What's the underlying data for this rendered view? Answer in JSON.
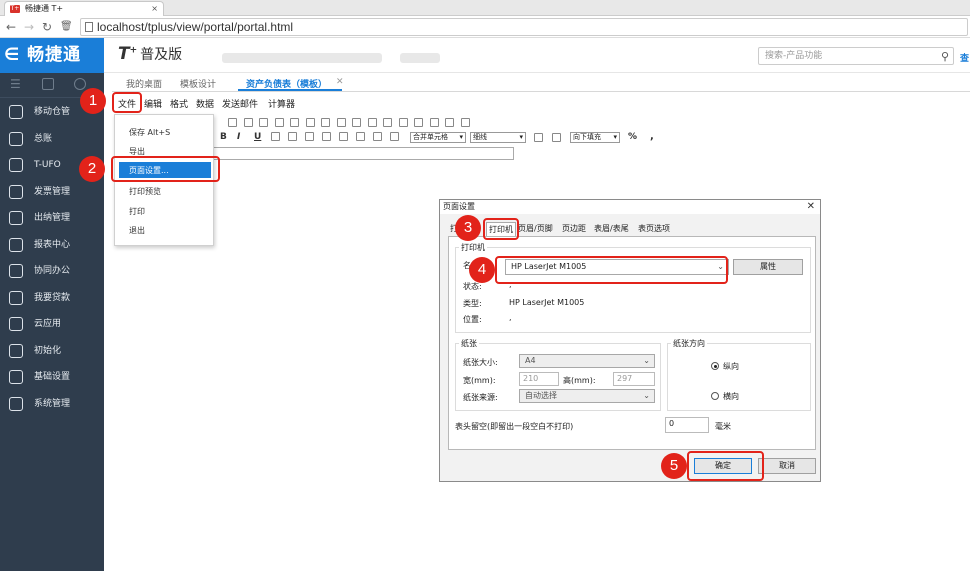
{
  "browser": {
    "tab_title": "畅捷通 T+",
    "favicon_text": "T+",
    "url": "localhost/tplus/view/portal/portal.html"
  },
  "app": {
    "logo_text": "∈ 畅捷通",
    "brand": "T",
    "brand_sup": "+",
    "edition": "普及版",
    "search_placeholder": "搜索-产品功能",
    "header_cut_text": "查"
  },
  "sidebar": {
    "items": [
      {
        "label": "移动仓管",
        "icon": "mobile-warehouse-icon"
      },
      {
        "label": "总账",
        "icon": "ledger-icon"
      },
      {
        "label": "T-UFO",
        "icon": "ufo-report-icon"
      },
      {
        "label": "发票管理",
        "icon": "invoice-icon"
      },
      {
        "label": "出纳管理",
        "icon": "cashier-icon"
      },
      {
        "label": "报表中心",
        "icon": "report-center-icon"
      },
      {
        "label": "协同办公",
        "icon": "collaboration-icon"
      },
      {
        "label": "我要贷款",
        "icon": "loan-icon"
      },
      {
        "label": "云应用",
        "icon": "cloud-icon"
      },
      {
        "label": "初始化",
        "icon": "initialize-icon"
      },
      {
        "label": "基础设置",
        "icon": "settings-icon"
      },
      {
        "label": "系统管理",
        "icon": "system-icon"
      }
    ]
  },
  "page_tabs": [
    {
      "label": "我的桌面"
    },
    {
      "label": "模板设计"
    },
    {
      "label": "资产负债表（模板）",
      "close": "✕"
    }
  ],
  "menubar": [
    "文件",
    "编辑",
    "格式",
    "数据",
    "发送邮件",
    "计算器"
  ],
  "toolbar": {
    "merge_select": "合并单元格",
    "border_select": "细线",
    "fill_select": "向下填充",
    "percent": "%",
    "comma": ","
  },
  "file_menu": [
    "保存 Alt+S",
    "导出",
    "页面设置...",
    "打印预览",
    "打印",
    "退出"
  ],
  "dialog": {
    "title": "页面设置",
    "close": "✕",
    "tabs": [
      "打印机",
      "页眉/页脚",
      "页边距",
      "表眉/表尾",
      "表页选项"
    ],
    "printer_group": "打印机",
    "name_label": "名",
    "printer_name": "HP LaserJet M1005",
    "properties_button": "属性",
    "status_label": "状态:",
    "status_value": ",",
    "type_label": "类型:",
    "type_value": "HP LaserJet M1005",
    "location_label": "位置:",
    "location_value": ",",
    "paper_group": "纸张",
    "paper_size_label": "纸张大小:",
    "paper_size": "A4",
    "width_label": "宽(mm):",
    "width_value": "210",
    "height_label": "高(mm):",
    "height_value": "297",
    "source_label": "纸张来源:",
    "source_value": "自动选择",
    "orientation_group": "纸张方向",
    "portrait": "纵向",
    "landscape": "横向",
    "header_space_label": "表头留空(即留出一段空白不打印)",
    "header_space_value": "0",
    "header_space_unit": "毫米",
    "ok_button": "确定",
    "cancel_button": "取消"
  },
  "annotations": [
    "1",
    "2",
    "3",
    "4",
    "5"
  ],
  "colors": {
    "accent": "#1a7ed8",
    "sidebar": "#2f3d4d",
    "annotation": "#e2231a"
  }
}
